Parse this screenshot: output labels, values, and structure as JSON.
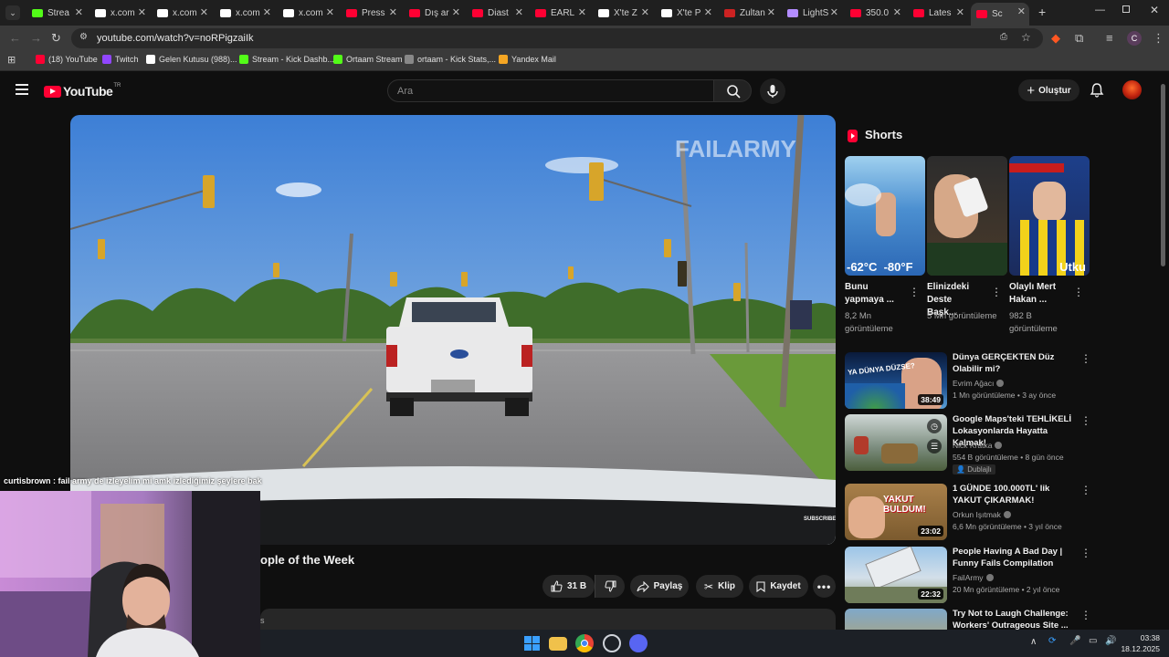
{
  "browser": {
    "tabs": [
      {
        "label": "Strea",
        "color": "#53fc18"
      },
      {
        "label": "x.com",
        "color": "#ffffff"
      },
      {
        "label": "x.com",
        "color": "#ffffff"
      },
      {
        "label": "x.com",
        "color": "#ffffff"
      },
      {
        "label": "x.com",
        "color": "#ffffff"
      },
      {
        "label": "Press",
        "color": "#ff0033"
      },
      {
        "label": "Dış ar",
        "color": "#ff0033"
      },
      {
        "label": "Diast",
        "color": "#ff0033"
      },
      {
        "label": "EARL",
        "color": "#ff0033"
      },
      {
        "label": "X'te Z",
        "color": "#ffffff"
      },
      {
        "label": "X'te P",
        "color": "#ffffff"
      },
      {
        "label": "Zultan",
        "color": "#cc2222"
      },
      {
        "label": "LightS",
        "color": "#b38cff"
      },
      {
        "label": "350.0",
        "color": "#ff0033"
      },
      {
        "label": "Lates",
        "color": "#ff0033"
      },
      {
        "label": "Sc",
        "color": "#ff0033"
      }
    ],
    "url": "youtube.com/watch?v=noRPigzaiIk",
    "bookmarks": [
      {
        "label": "(18) YouTube",
        "color": "#ff0033"
      },
      {
        "label": "Twitch",
        "color": "#9146ff"
      },
      {
        "label": "Gelen Kutusu (988)...",
        "color": "#ffffff"
      },
      {
        "label": "Stream - Kick Dashb...",
        "color": "#53fc18"
      },
      {
        "label": "Ortaam Stream",
        "color": "#53fc18"
      },
      {
        "label": "ortaam - Kick Stats,...",
        "color": "#888888"
      },
      {
        "label": "Yandex Mail",
        "color": "#f5a623"
      }
    ],
    "profile_letter": "C"
  },
  "youtube": {
    "logo_text": "YouTube",
    "logo_region": "TR",
    "search_placeholder": "Ara",
    "create_label": "Oluştur",
    "video": {
      "watermark": "FAILARMY",
      "subscribe_mark": "SUBSCRIBE",
      "title_visible": "ople of the Week",
      "likes": "31 B",
      "share_label": "Paylaş",
      "clip_label": "Klip",
      "save_label": "Kaydet",
      "desc_fragment": "s"
    },
    "shorts_title": "Shorts",
    "shorts": [
      {
        "title": "Bunu yapmaya ...",
        "views": "8,2 Mn görüntüleme",
        "overlay": "-62°C  -80°F"
      },
      {
        "title": "Elinizdeki Deste Başk...",
        "views": "5 Mn görüntüleme",
        "overlay": ""
      },
      {
        "title": "Olaylı Mert Hakan ...",
        "views": "982 B görüntüleme",
        "overlay": "Utku"
      }
    ],
    "recommended": [
      {
        "title": "Dünya GERÇEKTEN Düz Olabilir mi?",
        "channel": "Evrim Ağacı",
        "meta": "1 Mn görüntüleme • 3 ay önce",
        "duration": "38:49",
        "badge": "",
        "thumb_text": "YA DÜNYA DÜZSE?"
      },
      {
        "title": "Google Maps'teki TEHLİKELİ Lokasyonlarda Hayatta Kalmak!",
        "channel": "Nick Kratka",
        "meta": "554 B görüntüleme • 8 gün önce",
        "duration": "",
        "badge": "Dublajlı",
        "thumb_text": ""
      },
      {
        "title": "1 GÜNDE 100.000TL' lik YAKUT ÇIKARMAK!",
        "channel": "Orkun Işıtmak",
        "meta": "6,6 Mn görüntüleme • 3 yıl önce",
        "duration": "23:02",
        "badge": "",
        "thumb_text": "YAKUT BULDUM!"
      },
      {
        "title": "People Having A Bad Day | Funny Fails Compilation",
        "channel": "FailArmy",
        "meta": "20 Mn görüntüleme • 2 yıl önce",
        "duration": "22:32",
        "badge": "",
        "thumb_text": ""
      },
      {
        "title": "Try Not to Laugh Challenge: Workers' Outrageous Site ...",
        "channel": "",
        "meta": "",
        "duration": "",
        "badge": "",
        "thumb_text": ""
      }
    ]
  },
  "stream_overlay": {
    "chat_line": "curtisbrown : fail army de izleyelim mi amk izlediğimiz şeylere bak"
  },
  "taskbar": {
    "time": "03:38",
    "date": "18.12.2025"
  }
}
